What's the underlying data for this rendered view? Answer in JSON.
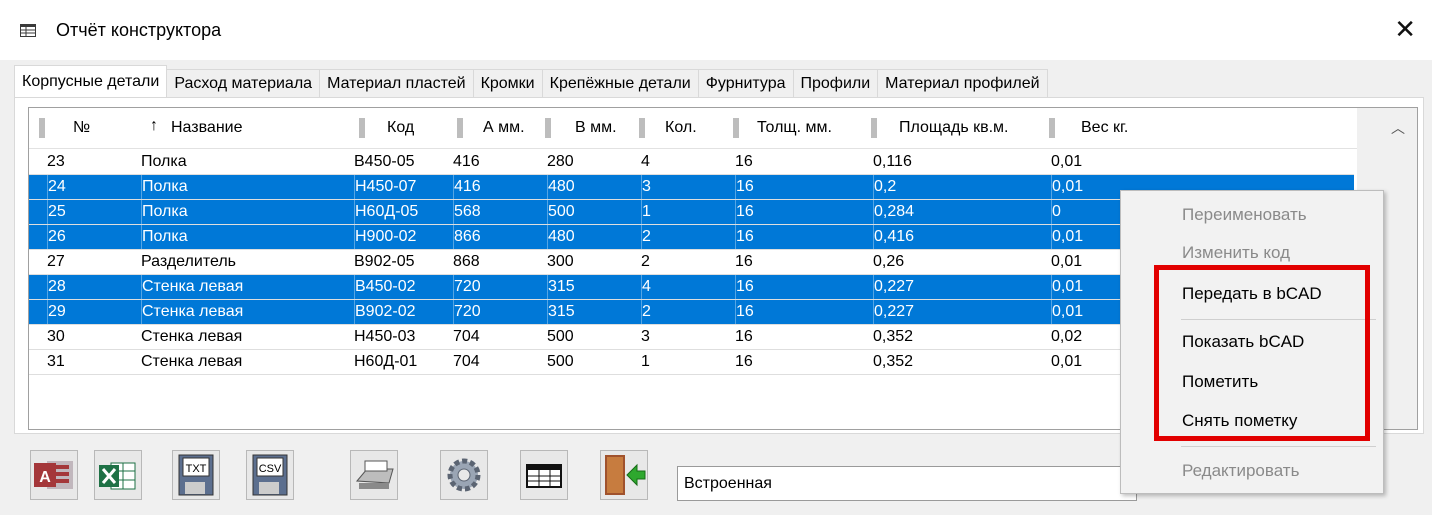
{
  "window": {
    "title": "Отчёт конструктора",
    "close_glyph": "✕"
  },
  "tabs": [
    {
      "label": "Корпусные детали",
      "active": true
    },
    {
      "label": "Расход материала"
    },
    {
      "label": "Материал пластей"
    },
    {
      "label": "Кромки"
    },
    {
      "label": "Крепёжные детали"
    },
    {
      "label": "Фурнитура"
    },
    {
      "label": "Профили"
    },
    {
      "label": "Материал профилей"
    }
  ],
  "table": {
    "columns": [
      "№",
      "Название",
      "Код",
      "А мм.",
      "В мм.",
      "Кол.",
      "Толщ. мм.",
      "Площадь кв.м.",
      "Вес кг."
    ],
    "rows": [
      {
        "n": "23",
        "name": "Полка",
        "code": "В450-05",
        "a": "416",
        "b": "280",
        "qty": "4",
        "th": "16",
        "area": "0,116",
        "w": "0,01",
        "selected": false
      },
      {
        "n": "24",
        "name": "Полка",
        "code": "Н450-07",
        "a": "416",
        "b": "480",
        "qty": "3",
        "th": "16",
        "area": "0,2",
        "w": "0,01",
        "selected": true
      },
      {
        "n": "25",
        "name": "Полка",
        "code": "Н60Д-05",
        "a": "568",
        "b": "500",
        "qty": "1",
        "th": "16",
        "area": "0,284",
        "w": "0",
        "selected": true
      },
      {
        "n": "26",
        "name": "Полка",
        "code": "Н900-02",
        "a": "866",
        "b": "480",
        "qty": "2",
        "th": "16",
        "area": "0,416",
        "w": "0,01",
        "selected": true
      },
      {
        "n": "27",
        "name": "Разделитель",
        "code": "В902-05",
        "a": "868",
        "b": "300",
        "qty": "2",
        "th": "16",
        "area": "0,26",
        "w": "0,01",
        "selected": false
      },
      {
        "n": "28",
        "name": "Стенка левая",
        "code": "В450-02",
        "a": "720",
        "b": "315",
        "qty": "4",
        "th": "16",
        "area": "0,227",
        "w": "0,01",
        "selected": true
      },
      {
        "n": "29",
        "name": "Стенка левая",
        "code": "В902-02",
        "a": "720",
        "b": "315",
        "qty": "2",
        "th": "16",
        "area": "0,227",
        "w": "0,01",
        "selected": true
      },
      {
        "n": "30",
        "name": "Стенка левая",
        "code": "Н450-03",
        "a": "704",
        "b": "500",
        "qty": "3",
        "th": "16",
        "area": "0,352",
        "w": "0,02",
        "selected": false
      },
      {
        "n": "31",
        "name": "Стенка левая",
        "code": "Н60Д-01",
        "a": "704",
        "b": "500",
        "qty": "1",
        "th": "16",
        "area": "0,352",
        "w": "0,01",
        "selected": false
      }
    ]
  },
  "context_menu": {
    "rename": "Переименовать",
    "change_code": "Изменить код",
    "send_bcad": "Передать в bCAD",
    "show_bcad": "Показать bCAD",
    "mark": "Пометить",
    "unmark": "Снять пометку",
    "edit": "Редактировать"
  },
  "toolbar": {
    "txt_label": "TXT",
    "csv_label": "CSV",
    "access_letter": "A",
    "report_combo_value": "Встроенная"
  },
  "colors": {
    "selection": "#0078d7",
    "highlight_box": "#e20000"
  }
}
